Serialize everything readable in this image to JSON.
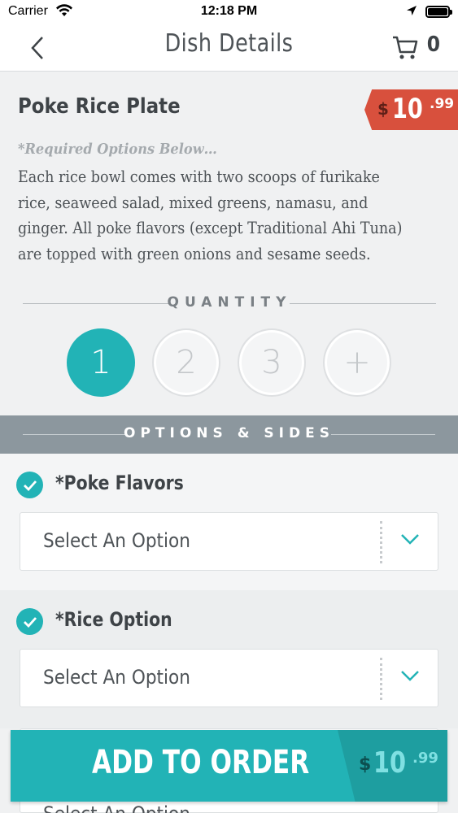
{
  "status_bar": {
    "carrier": "Carrier",
    "time": "12:18 PM"
  },
  "nav": {
    "title": "Dish Details",
    "cart_count": "0"
  },
  "dish": {
    "name": "Poke Rice Plate",
    "price": {
      "currency": "$",
      "whole": "10",
      "cents": ".99"
    },
    "required_note": "*Required Options Below…",
    "description": "Each rice bowl comes with two scoops of furikake rice, seaweed salad, mixed greens, namasu, and ginger.  All poke flavors (except Traditional Ahi Tuna) are topped with green onions and sesame seeds."
  },
  "quantity": {
    "label": "QUANTITY",
    "options": [
      "1",
      "2",
      "3",
      "+"
    ],
    "selected": "1"
  },
  "options_section": {
    "label": "OPTIONS & SIDES"
  },
  "option_groups": [
    {
      "title": "*Poke Flavors",
      "placeholder": "Select An Option"
    },
    {
      "title": "*Rice Option",
      "placeholder": "Select An Option"
    },
    {
      "title": "",
      "placeholder": "Select An Option"
    }
  ],
  "add_to_order": {
    "label": "ADD TO ORDER",
    "price": {
      "currency": "$",
      "whole": "10",
      "cents": ".99"
    }
  },
  "colors": {
    "accent": "#22b3b6",
    "price_tag": "#d8503d",
    "band": "#8c979e"
  },
  "icons": [
    "wifi-icon",
    "location-arrow-icon",
    "battery-icon",
    "back-chevron-icon",
    "cart-icon",
    "check-icon",
    "chevron-down-icon"
  ]
}
